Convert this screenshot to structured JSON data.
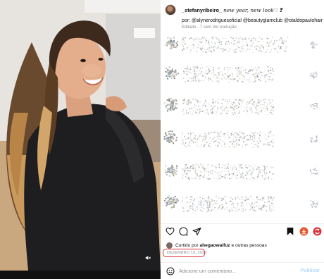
{
  "post": {
    "username": "_stefanyribeiro_",
    "caption": "new year, new look♡❣",
    "credits_label": "por:",
    "credits_handles": "@alynerodriguesoficial @beautyglamclub @otaldopaulohair",
    "edited": "Editado",
    "age": "7 sem",
    "translate": "Ver tradução"
  },
  "likes": {
    "prefix": "Curtido por",
    "user": "ahegaowaifuz",
    "suffix": "e outras pessoas"
  },
  "date": "DEZEMBRO 19, 2022",
  "comment": {
    "placeholder": "Adicione um comentário...",
    "value": "",
    "publish_label": "Publicar"
  },
  "icons": {
    "actions_left": [
      "heart-icon",
      "comment-icon",
      "share-icon"
    ],
    "actions_right": [
      "save-icon",
      "download-icon",
      "repost-icon"
    ],
    "mute": "speaker-muted-icon",
    "emoji": "emoji-icon"
  },
  "colors": {
    "highlight_red": "#d9323c",
    "publish_disabled": "#b3dbff",
    "muted_text": "#8e8e8e"
  }
}
